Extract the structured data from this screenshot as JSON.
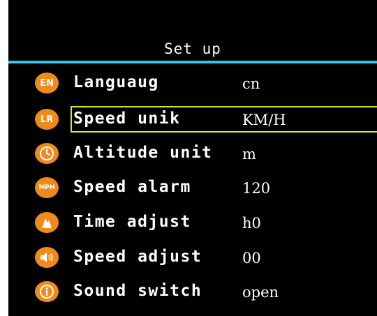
{
  "header": {
    "title": "Set up"
  },
  "colors": {
    "accent": "#3cc6e6",
    "icon_bg": "#f08a1a",
    "selection": "#e3e21d"
  },
  "menu": {
    "items": [
      {
        "icon": "en-icon",
        "icon_text": "EN",
        "label": "Languaug",
        "value": "cn",
        "selected": false
      },
      {
        "icon": "lr-icon",
        "icon_text": "LR",
        "label": "Speed unik",
        "value": "KM/H",
        "selected": true
      },
      {
        "icon": "clock-icon",
        "icon_text": "",
        "label": "Altitude unit",
        "value": "m",
        "selected": false
      },
      {
        "icon": "mph-icon",
        "icon_text": "MPH",
        "label": "Speed alarm",
        "value": "120",
        "selected": false
      },
      {
        "icon": "mountain-icon",
        "icon_text": "",
        "label": "Time adjust",
        "value": "h0",
        "selected": false
      },
      {
        "icon": "speaker-icon",
        "icon_text": "",
        "label": "Speed adjust",
        "value": "00",
        "selected": false
      },
      {
        "icon": "info-icon",
        "icon_text": "",
        "label": "Sound switch",
        "value": "open",
        "selected": false
      }
    ]
  }
}
